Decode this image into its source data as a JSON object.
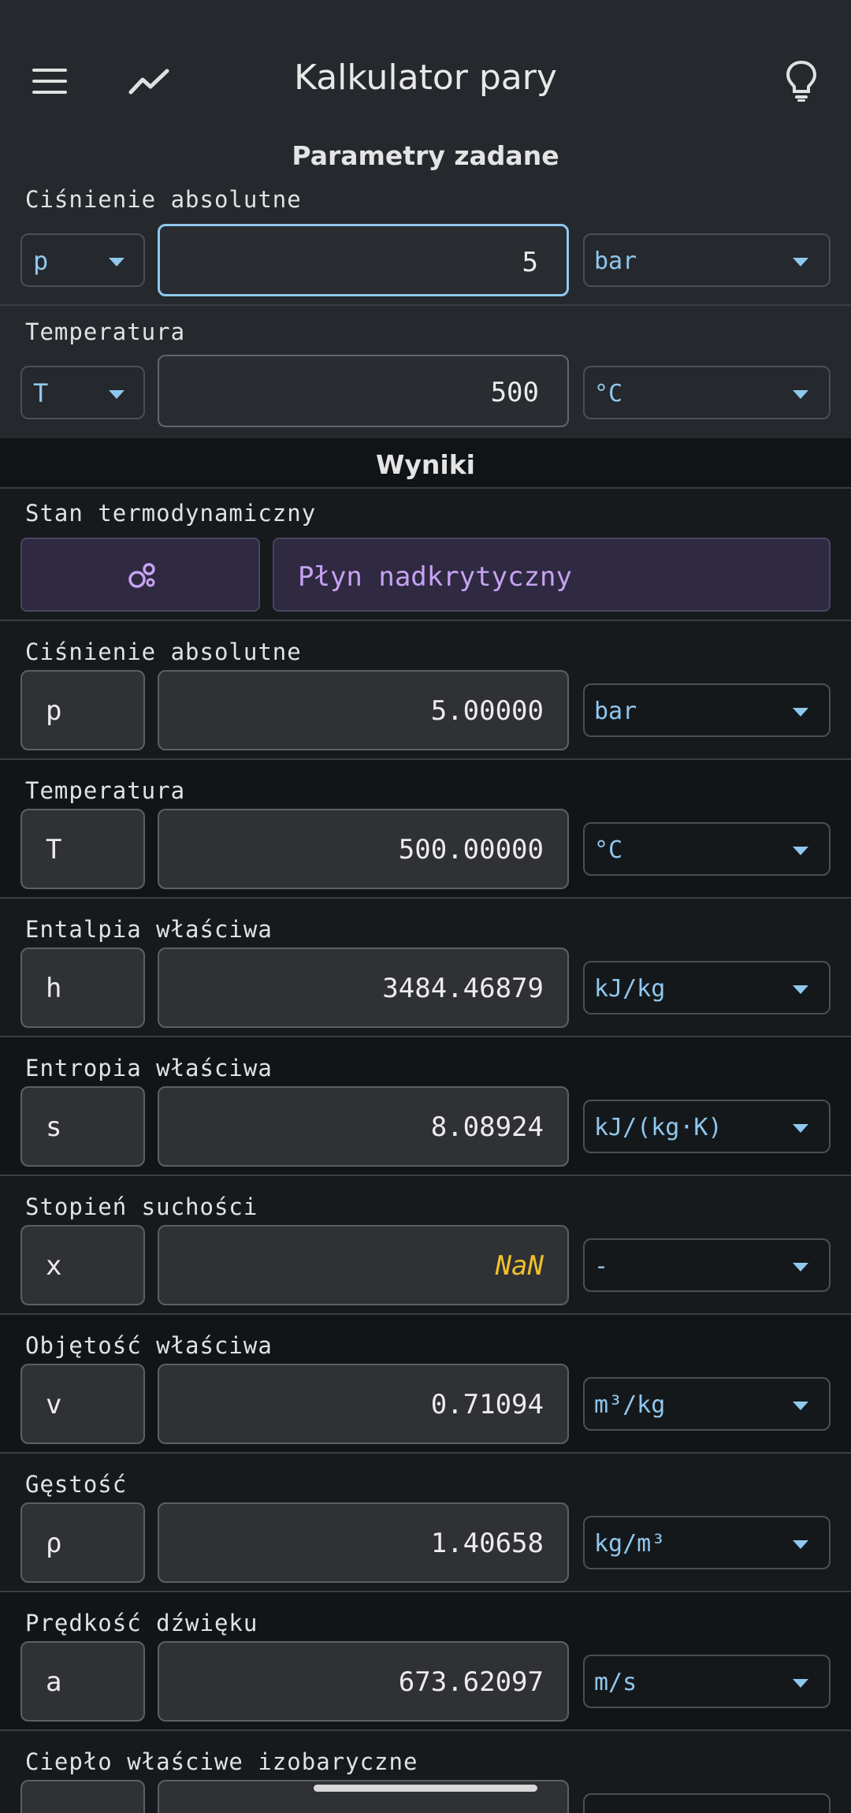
{
  "app": {
    "title": "Kalkulator pary"
  },
  "icons": {
    "menu": "menu-icon",
    "chart": "trend-chart-icon",
    "hint": "lightbulb-icon",
    "state": "bubbles-icon"
  },
  "colors": {
    "accent": "#8fc8ef",
    "nan": "#f0c02c",
    "state": "#c7a2f2"
  },
  "inputs": {
    "section_title": "Parametry zadane",
    "rows": [
      {
        "label": "Ciśnienie absolutne",
        "symbol": "p",
        "value": "5",
        "unit": "bar",
        "focused": true
      },
      {
        "label": "Temperatura",
        "symbol": "T",
        "value": "500",
        "unit": "°C",
        "focused": false
      }
    ]
  },
  "results": {
    "section_title": "Wyniki",
    "state": {
      "label": "Stan termodynamiczny",
      "value": "Płyn nadkrytyczny"
    },
    "rows": [
      {
        "label": "Ciśnienie absolutne",
        "symbol": "p",
        "value": "5.00000",
        "unit": "bar"
      },
      {
        "label": "Temperatura",
        "symbol": "T",
        "value": "500.00000",
        "unit": "°C"
      },
      {
        "label": "Entalpia właściwa",
        "symbol": "h",
        "value": "3484.46879",
        "unit": "kJ/kg"
      },
      {
        "label": "Entropia właściwa",
        "symbol": "s",
        "value": "8.08924",
        "unit": "kJ/(kg·K)"
      },
      {
        "label": "Stopień suchości",
        "symbol": "x",
        "value": "NaN",
        "unit": "-"
      },
      {
        "label": "Objętość właściwa",
        "symbol": "v",
        "value": "0.71094",
        "unit": "m³/kg"
      },
      {
        "label": "Gęstość",
        "symbol": "ρ",
        "value": "1.40658",
        "unit": "kg/m³"
      },
      {
        "label": "Prędkość dźwięku",
        "symbol": "a",
        "value": "673.62097",
        "unit": "m/s"
      },
      {
        "label": "Ciepło właściwe izobaryczne",
        "symbol": "",
        "value": "",
        "unit": ""
      }
    ]
  }
}
